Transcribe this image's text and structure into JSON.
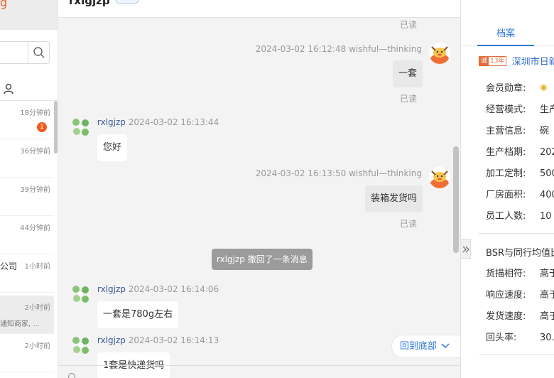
{
  "app": {
    "title_fragment": "g"
  },
  "left": {
    "conversations": [
      {
        "time": "18分钟前",
        "badge": "1",
        "name": "",
        "sub": ""
      },
      {
        "time": "36分钟前",
        "badge": "",
        "name": "",
        "sub": ""
      },
      {
        "time": "39分钟前",
        "badge": "",
        "name": "",
        "sub": ""
      },
      {
        "time": "44分钟前",
        "badge": "",
        "name": "",
        "sub": ""
      },
      {
        "time": "1小时前",
        "badge": "",
        "name": "公司",
        "sub": ""
      },
      {
        "time": "2小时前",
        "badge": "",
        "name": "",
        "sub": "通知商家, ..."
      },
      {
        "time": "2小时前",
        "badge": "",
        "name": "",
        "sub": ""
      }
    ]
  },
  "chat": {
    "contact_name": "rxlgjzp",
    "read_label": "已读",
    "messages": [
      {
        "meta": "2024-03-02 16:12:48",
        "sender": "wishful—thinking",
        "text": "一套",
        "side": "right"
      },
      {
        "meta": "2024-03-02 16:13:44",
        "sender": "rxlgjzp",
        "text": "您好",
        "side": "left"
      },
      {
        "meta": "2024-03-02 16:13:50",
        "sender": "wishful—thinking",
        "text": "装箱发货吗",
        "side": "right"
      },
      {
        "meta": "2024-03-02 16:14:06",
        "sender": "rxlgjzp",
        "text": "一套是780g左右",
        "side": "left"
      },
      {
        "meta": "2024-03-02 16:14:13",
        "sender": "rxlgjzp",
        "text": "1套是快递货吗",
        "side": "left"
      }
    ],
    "recall_notice": "rxlgjzp 撤回了一条消息",
    "to_bottom": "回到底部"
  },
  "profile": {
    "tab": "档案",
    "years_badge_a": "诚",
    "years_badge_b": "13年",
    "company": "深圳市日新",
    "rows": [
      {
        "label": "会员勋章:",
        "value": ""
      },
      {
        "label": "经营模式:",
        "value": "生产"
      },
      {
        "label": "主营信息:",
        "value": "碗"
      },
      {
        "label": "生产档期:",
        "value": "202"
      },
      {
        "label": "加工定制:",
        "value": "500"
      },
      {
        "label": "厂房面积:",
        "value": "400"
      },
      {
        "label": "员工人数:",
        "value": "10"
      }
    ],
    "bsr_title": "BSR与同行均值比",
    "bsr_rows": [
      {
        "label": "货描相符:",
        "value": "高于"
      },
      {
        "label": "响应速度:",
        "value": "高于"
      },
      {
        "label": "发货速度:",
        "value": "高于"
      },
      {
        "label": "回头率:",
        "value": "30."
      }
    ]
  }
}
